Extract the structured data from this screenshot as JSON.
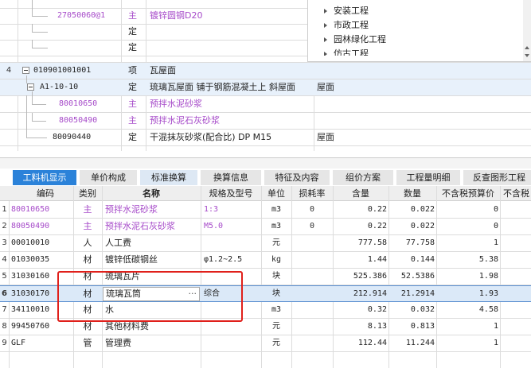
{
  "top_table": {
    "rows": [
      {
        "code": "",
        "type": "",
        "name": "",
        "unit": ""
      },
      {
        "code": "27050060@1",
        "type": "主",
        "name": "镀锌圆钢D20",
        "unit": ""
      },
      {
        "code": "",
        "type": "定",
        "name": "",
        "unit": ""
      },
      {
        "code": "",
        "type": "定",
        "name": "",
        "unit": ""
      },
      {
        "rownum": "4",
        "code": "010901001001",
        "type": "项",
        "name": "瓦屋面",
        "unit": ""
      },
      {
        "code": "A1-10-10",
        "type": "定",
        "name": "琉璃瓦屋面 铺于钢筋混凝土上 斜屋面",
        "unit": "屋面"
      },
      {
        "code": "80010650",
        "type": "主",
        "name": "预拌水泥砂浆",
        "unit": ""
      },
      {
        "code": "80050490",
        "type": "主",
        "name": "预拌水泥石灰砂浆",
        "unit": ""
      },
      {
        "code": "80090440",
        "type": "定",
        "name": "干混抹灰砂浆(配合比) DP M15",
        "unit": "屋面"
      }
    ]
  },
  "tree_panel": {
    "items": [
      "安装工程",
      "市政工程",
      "园林绿化工程",
      "仿古工程"
    ]
  },
  "tabs": [
    {
      "label": "工料机显示"
    },
    {
      "label": "单价构成"
    },
    {
      "label": "标准换算"
    },
    {
      "label": "换算信息"
    },
    {
      "label": "特征及内容"
    },
    {
      "label": "组价方案"
    },
    {
      "label": "工程量明细"
    },
    {
      "label": "反查图形工程量"
    }
  ],
  "grid": {
    "headers": [
      "编码",
      "类别",
      "名称",
      "规格及型号",
      "单位",
      "损耗率",
      "含量",
      "数量",
      "不含税预算价",
      "不含税"
    ],
    "rows": [
      {
        "n": "1",
        "code": "80010650",
        "type": "主",
        "name": "预拌水泥砂浆",
        "spec": "1:3",
        "unit": "m3",
        "loss": "0",
        "content": "0.22",
        "qty": "0.022",
        "price": "0"
      },
      {
        "n": "2",
        "code": "80050490",
        "type": "主",
        "name": "预拌水泥石灰砂浆",
        "spec": "M5.0",
        "unit": "m3",
        "loss": "0",
        "content": "0.22",
        "qty": "0.022",
        "price": "0"
      },
      {
        "n": "3",
        "code": "00010010",
        "type": "人",
        "name": "人工费",
        "spec": "",
        "unit": "元",
        "loss": "",
        "content": "777.58",
        "qty": "77.758",
        "price": "1"
      },
      {
        "n": "4",
        "code": "01030035",
        "type": "材",
        "name": "镀锌低碳钢丝",
        "spec": "φ1.2~2.5",
        "unit": "kg",
        "loss": "",
        "content": "1.44",
        "qty": "0.144",
        "price": "5.38"
      },
      {
        "n": "5",
        "code": "31030160",
        "type": "材",
        "name": "琉璃瓦片",
        "spec": "",
        "unit": "块",
        "loss": "",
        "content": "525.386",
        "qty": "52.5386",
        "price": "1.98"
      },
      {
        "n": "6",
        "code": "31030170",
        "type": "材",
        "name": "琉璃瓦筒",
        "spec": "综合",
        "unit": "块",
        "loss": "",
        "content": "212.914",
        "qty": "21.2914",
        "price": "1.93"
      },
      {
        "n": "7",
        "code": "34110010",
        "type": "材",
        "name": "水",
        "spec": "",
        "unit": "m3",
        "loss": "",
        "content": "0.32",
        "qty": "0.032",
        "price": "4.58"
      },
      {
        "n": "8",
        "code": "99450760",
        "type": "材",
        "name": "其他材料费",
        "spec": "",
        "unit": "元",
        "loss": "",
        "content": "8.13",
        "qty": "0.813",
        "price": "1"
      },
      {
        "n": "9",
        "code": "GLF",
        "type": "管",
        "name": "管理费",
        "spec": "",
        "unit": "元",
        "loss": "",
        "content": "112.44",
        "qty": "11.244",
        "price": "1"
      }
    ]
  },
  "ellipsis": "···",
  "colors": {
    "accent": "#2b82d9",
    "highlight_box": "#e0201b",
    "purple_text": "#a64ac9"
  }
}
